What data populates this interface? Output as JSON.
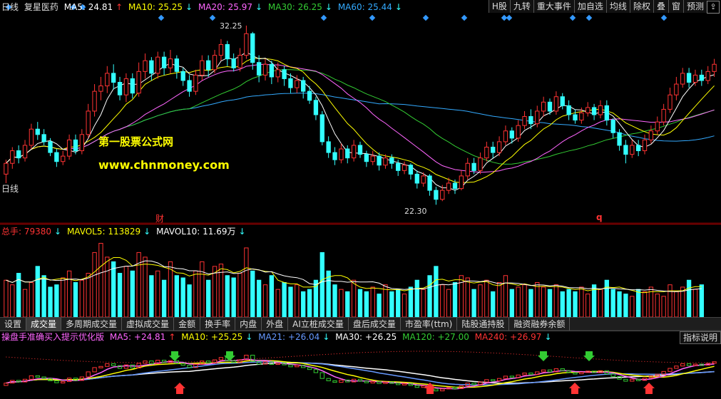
{
  "header": {
    "period": "日线",
    "stock_name": "复星医药",
    "ma5": "MA5: 24.81",
    "ma10": "MA10: 25.25",
    "ma20": "MA20: 25.97",
    "ma30": "MA30: 26.25",
    "ma60": "MA60: 25.44",
    "toolbar": [
      "H股",
      "九转",
      "重大事件",
      "加自选",
      "均线",
      "除权",
      "叠",
      "窗",
      "预测"
    ]
  },
  "kline": {
    "high_label": "32.25",
    "low_label": "22.30",
    "watermark1": "第一股票公式网",
    "watermark2": "www.chnmoney.com",
    "marker_cai": "财",
    "marker_q": "q",
    "left_label": "日线"
  },
  "volume": {
    "title": "总手: 79380",
    "mavol5": "MAVOL5: 113829",
    "mavol10": "MAVOL10: 11.69万"
  },
  "tabs": [
    "设置",
    "成交量",
    "多周期成交量",
    "虚拟成交量",
    "金额",
    "换手率",
    "内盘",
    "外盘",
    "AI立桩成交量",
    "盘后成交量",
    "市盈率(ttm)",
    "陆股通持股",
    "融资融券余额"
  ],
  "active_tab": "成交量",
  "indicator": {
    "title": "操盘手准确买入提示优化版",
    "ma5": "MA5: +24.81",
    "ma10": "MA10: +25.25",
    "ma21": "MA21: +26.04",
    "ma30": "MA30: +26.25",
    "ma120": "MA120: +27.00",
    "ma240": "MA240: +26.97",
    "right_button": "指标说明"
  },
  "colors": {
    "up": "#ff3333",
    "down": "#33ffff",
    "ma5": "#ffffff",
    "ma10": "#ffff00",
    "ma20": "#ff66ff",
    "ma30": "#33cc33",
    "ma60": "#33aaff",
    "watermark": "#ffff00"
  },
  "chart_data": {
    "type": "candlestick",
    "price_range": [
      22.3,
      32.25
    ],
    "candles": [
      [
        24.0,
        24.6,
        23.5,
        24.8
      ],
      [
        24.6,
        25.3,
        24.3,
        25.5
      ],
      [
        25.3,
        24.9,
        24.6,
        25.6
      ],
      [
        24.9,
        25.6,
        24.7,
        25.9
      ],
      [
        25.6,
        26.5,
        25.4,
        26.8
      ],
      [
        26.5,
        26.2,
        25.9,
        26.9
      ],
      [
        26.2,
        25.8,
        25.6,
        26.5
      ],
      [
        25.8,
        25.2,
        25.0,
        26.0
      ],
      [
        25.2,
        24.7,
        24.4,
        25.4
      ],
      [
        24.7,
        25.0,
        24.5,
        25.3
      ],
      [
        25.0,
        25.9,
        24.8,
        26.2
      ],
      [
        25.9,
        25.3,
        25.1,
        26.2
      ],
      [
        25.3,
        26.2,
        25.1,
        26.5
      ],
      [
        26.2,
        27.5,
        26.0,
        27.9
      ],
      [
        27.5,
        28.6,
        27.2,
        29.0
      ],
      [
        28.6,
        28.9,
        28.1,
        29.4
      ],
      [
        28.9,
        29.6,
        28.5,
        30.0
      ],
      [
        29.6,
        29.1,
        28.7,
        30.1
      ],
      [
        29.1,
        28.4,
        28.1,
        29.4
      ],
      [
        28.4,
        29.3,
        28.0,
        29.6
      ],
      [
        29.3,
        28.5,
        28.2,
        29.6
      ],
      [
        28.5,
        29.7,
        28.3,
        30.2
      ],
      [
        29.7,
        30.3,
        29.3,
        30.7
      ],
      [
        30.3,
        29.6,
        29.2,
        30.5
      ],
      [
        29.6,
        30.5,
        29.3,
        30.8
      ],
      [
        30.5,
        29.9,
        29.5,
        30.8
      ],
      [
        29.9,
        30.4,
        29.6,
        30.9
      ],
      [
        30.4,
        29.7,
        29.3,
        30.6
      ],
      [
        29.7,
        29.2,
        28.9,
        29.9
      ],
      [
        29.2,
        28.6,
        28.3,
        29.5
      ],
      [
        28.6,
        29.5,
        28.4,
        29.8
      ],
      [
        29.5,
        30.3,
        29.2,
        30.6
      ],
      [
        30.3,
        29.8,
        29.4,
        30.6
      ],
      [
        29.8,
        30.6,
        29.6,
        30.9
      ],
      [
        30.6,
        31.2,
        30.3,
        31.5
      ],
      [
        31.2,
        30.4,
        30.0,
        31.4
      ],
      [
        30.4,
        29.9,
        29.7,
        30.7
      ],
      [
        29.9,
        30.6,
        29.7,
        31.0
      ],
      [
        30.6,
        31.8,
        30.4,
        32.25
      ],
      [
        31.8,
        30.2,
        29.8,
        31.9
      ],
      [
        30.2,
        29.5,
        29.1,
        30.6
      ],
      [
        29.5,
        30.1,
        29.2,
        30.4
      ],
      [
        30.1,
        29.4,
        29.0,
        30.3
      ],
      [
        29.4,
        29.8,
        29.1,
        30.2
      ],
      [
        29.8,
        29.3,
        28.9,
        30.0
      ],
      [
        29.3,
        28.8,
        28.5,
        29.6
      ],
      [
        28.8,
        29.2,
        28.5,
        29.5
      ],
      [
        29.2,
        28.6,
        28.2,
        29.4
      ],
      [
        28.6,
        28.1,
        27.9,
        28.9
      ],
      [
        28.1,
        27.3,
        27.0,
        28.3
      ],
      [
        27.3,
        25.8,
        25.6,
        27.5
      ],
      [
        25.8,
        25.2,
        24.9,
        26.1
      ],
      [
        25.2,
        24.8,
        24.5,
        25.5
      ],
      [
        24.8,
        25.4,
        24.6,
        25.7
      ],
      [
        25.4,
        24.9,
        24.6,
        25.6
      ],
      [
        24.9,
        25.6,
        24.7,
        25.9
      ],
      [
        25.6,
        25.1,
        24.9,
        25.8
      ],
      [
        25.1,
        24.7,
        24.4,
        25.3
      ],
      [
        24.7,
        25.0,
        24.5,
        25.3
      ],
      [
        25.0,
        24.5,
        24.2,
        25.2
      ],
      [
        24.5,
        24.9,
        24.3,
        25.1
      ],
      [
        24.9,
        24.6,
        24.3,
        25.1
      ],
      [
        24.6,
        24.2,
        23.9,
        24.8
      ],
      [
        24.2,
        24.5,
        24.0,
        24.7
      ],
      [
        24.5,
        24.0,
        23.7,
        24.6
      ],
      [
        24.0,
        23.5,
        23.2,
        24.2
      ],
      [
        23.5,
        23.9,
        23.3,
        24.1
      ],
      [
        23.9,
        23.1,
        22.8,
        24.0
      ],
      [
        23.1,
        22.6,
        22.3,
        23.3
      ],
      [
        22.6,
        23.1,
        22.5,
        23.4
      ],
      [
        23.1,
        23.5,
        22.9,
        23.8
      ],
      [
        23.5,
        23.2,
        22.9,
        23.7
      ],
      [
        23.2,
        23.9,
        23.1,
        24.2
      ],
      [
        23.9,
        24.6,
        23.7,
        24.9
      ],
      [
        24.6,
        24.2,
        24.0,
        24.9
      ],
      [
        24.2,
        24.9,
        24.0,
        25.2
      ],
      [
        24.9,
        25.5,
        24.7,
        25.8
      ],
      [
        25.5,
        25.2,
        24.9,
        25.8
      ],
      [
        25.2,
        25.8,
        25.0,
        26.1
      ],
      [
        25.8,
        26.4,
        25.6,
        26.7
      ],
      [
        26.4,
        26.0,
        25.7,
        26.6
      ],
      [
        26.0,
        26.7,
        25.8,
        27.0
      ],
      [
        26.7,
        27.2,
        26.5,
        27.5
      ],
      [
        27.2,
        26.8,
        26.5,
        27.6
      ],
      [
        26.8,
        27.5,
        26.6,
        27.8
      ],
      [
        27.5,
        28.0,
        27.2,
        28.3
      ],
      [
        28.0,
        27.5,
        27.3,
        28.2
      ],
      [
        27.5,
        28.3,
        27.3,
        28.6
      ],
      [
        28.3,
        27.8,
        27.6,
        28.5
      ],
      [
        27.8,
        27.3,
        27.0,
        28.1
      ],
      [
        27.3,
        27.0,
        26.8,
        27.6
      ],
      [
        27.0,
        27.4,
        26.8,
        27.7
      ],
      [
        27.4,
        27.7,
        27.2,
        28.0
      ],
      [
        27.7,
        27.3,
        27.0,
        27.9
      ],
      [
        27.3,
        27.8,
        27.1,
        28.1
      ],
      [
        27.8,
        27.0,
        26.7,
        28.1
      ],
      [
        27.0,
        26.3,
        26.0,
        27.1
      ],
      [
        26.3,
        25.6,
        25.3,
        26.5
      ],
      [
        25.6,
        25.1,
        24.6,
        25.9
      ],
      [
        25.1,
        25.6,
        24.9,
        25.9
      ],
      [
        25.6,
        25.3,
        25.0,
        25.9
      ],
      [
        25.3,
        25.9,
        25.1,
        26.2
      ],
      [
        25.9,
        26.4,
        25.7,
        26.7
      ],
      [
        26.4,
        26.9,
        26.2,
        27.2
      ],
      [
        26.9,
        27.6,
        26.7,
        27.9
      ],
      [
        27.6,
        28.4,
        27.4,
        28.8
      ],
      [
        28.4,
        29.0,
        28.1,
        29.4
      ],
      [
        29.0,
        29.6,
        28.8,
        29.9
      ],
      [
        29.6,
        29.1,
        28.8,
        29.9
      ],
      [
        29.1,
        29.5,
        28.9,
        29.8
      ],
      [
        29.5,
        29.2,
        28.9,
        29.8
      ],
      [
        29.2,
        29.7,
        29.0,
        30.0
      ],
      [
        29.7,
        30.1,
        29.4,
        30.4
      ]
    ],
    "volumes": [
      80,
      70,
      95,
      60,
      75,
      110,
      90,
      65,
      70,
      85,
      100,
      75,
      80,
      95,
      140,
      160,
      130,
      120,
      95,
      110,
      100,
      140,
      130,
      90,
      100,
      80,
      120,
      90,
      85,
      70,
      100,
      120,
      80,
      110,
      115,
      90,
      85,
      95,
      150,
      100,
      80,
      70,
      90,
      60,
      75,
      65,
      70,
      55,
      60,
      80,
      140,
      100,
      70,
      60,
      55,
      80,
      60,
      55,
      65,
      50,
      70,
      55,
      60,
      50,
      65,
      80,
      60,
      90,
      110,
      70,
      60,
      75,
      90,
      85,
      60,
      70,
      80,
      55,
      75,
      90,
      60,
      65,
      70,
      60,
      75,
      65,
      60,
      70,
      55,
      60,
      55,
      65,
      50,
      70,
      60,
      80,
      60,
      55,
      50,
      45,
      60,
      55,
      65,
      50,
      45,
      70,
      55,
      65,
      80,
      60,
      70
    ]
  }
}
